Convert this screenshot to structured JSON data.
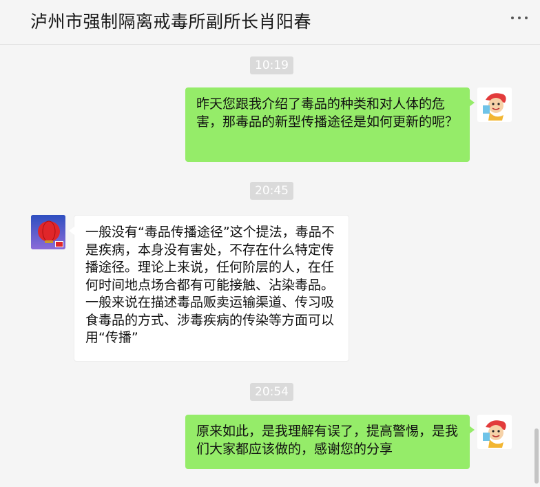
{
  "header": {
    "title": "泸州市强制隔离戒毒所副所长肖阳春"
  },
  "messages": [
    {
      "type": "time",
      "text": "10:19"
    },
    {
      "type": "sent",
      "text": "昨天您跟我介绍了毒品的种类和对人体的危害，那毒品的新型传播途径是如何更新的呢？"
    },
    {
      "type": "time",
      "text": "20:45"
    },
    {
      "type": "received",
      "text": "一般没有“毒品传播途径”这个提法，毒品不是疾病，本身没有害处，不存在什么特定传播途径。理论上来说，任何阶层的人，在任何时间地点场合都有可能接触、沾染毒品。一般来说在描述毒品贩卖运输渠道、传习吸食毒品的方式、涉毒疾病的传染等方面可以用“传播”"
    },
    {
      "type": "time",
      "text": "20:54"
    },
    {
      "type": "sent",
      "text": "原来如此，是我理解有误了，提高警惕，是我们大家都应该做的，感谢您的分享"
    }
  ],
  "colors": {
    "sent_bubble": "#95ec69",
    "received_bubble": "#ffffff",
    "background": "#f5f5f5"
  },
  "icons": {
    "more": "more-icon",
    "self_avatar": "cartoon-avatar",
    "contact_avatar": "lantern-avatar"
  }
}
